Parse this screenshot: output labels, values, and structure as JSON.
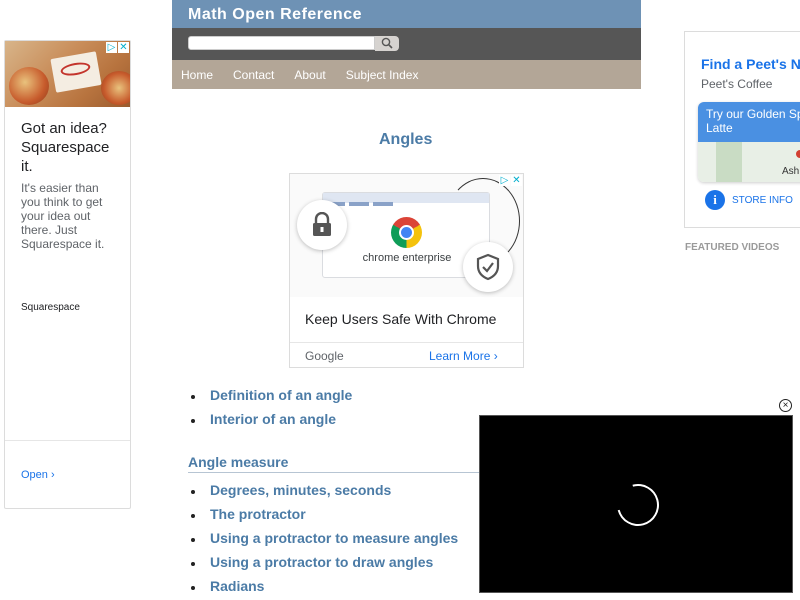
{
  "header": {
    "title": "Math Open Reference",
    "search": {
      "value": "",
      "placeholder": ""
    },
    "nav": [
      "Home",
      "Contact",
      "About",
      "Subject Index"
    ]
  },
  "main": {
    "title": "Angles",
    "list_a": [
      "Definition of an angle",
      "Interior of an angle"
    ],
    "section_heading": "Angle measure",
    "list_b": [
      "Degrees, minutes, seconds",
      "The protractor",
      "Using a protractor to measure angles",
      "Using a protractor to draw angles",
      "Radians"
    ]
  },
  "left_ad": {
    "headline": "Got an idea? Squarespace it.",
    "body": "It's easier than you think to get your idea out there. Just Squarespace it.",
    "brand": "Squarespace",
    "cta": "Open",
    "cta_icon": "chevron-right-icon",
    "adchoices_icon": "adchoices-icon",
    "close_icon": "close-icon"
  },
  "center_ad": {
    "graphic_text": "chrome enterprise",
    "headline": "Keep Users Safe With Chrome",
    "advertiser": "Google",
    "cta": "Learn More",
    "cta_icon": "chevron-right-icon"
  },
  "right_ad": {
    "headline": "Find a Peet's N",
    "advertiser": "Peet's Coffee",
    "promo": "Try our Golden Spi Latte",
    "map_label": "Ash",
    "cta": "STORE INFO",
    "info_glyph": "i"
  },
  "sidebar": {
    "featured_label": "FEATURED VIDEOS"
  },
  "video": {
    "close_glyph": "×"
  },
  "colors": {
    "title_bar": "#6e92b5",
    "search_bar": "#565656",
    "nav_bar": "#b3a697",
    "link": "#4b7ba6",
    "ad_link": "#1a73e8"
  }
}
